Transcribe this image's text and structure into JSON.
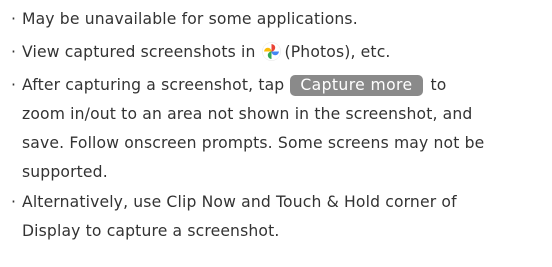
{
  "bullet": "·",
  "notes": [
    {
      "text": "May be unavailable for some applications."
    },
    {
      "before": "View captured screenshots in",
      "icon": "photos-app-icon",
      "after": "(Photos), etc."
    },
    {
      "before": "After capturing a screenshot, tap",
      "key": "Capture more",
      "after": "to",
      "lines": [
        "zoom in/out to an area not shown in the screenshot, and",
        "save. Follow onscreen prompts. Some screens may not be",
        "supported."
      ]
    },
    {
      "lines": [
        "Alternatively, use Clip Now and Touch & Hold corner of",
        "Display to capture a screenshot."
      ]
    }
  ],
  "colors": {
    "text": "#333333",
    "key_background": "#8a8a8a",
    "key_text": "#ffffff",
    "photos_red": "#ea4335",
    "photos_yellow": "#fbbc05",
    "photos_green": "#34a853",
    "photos_blue": "#4285f4"
  }
}
